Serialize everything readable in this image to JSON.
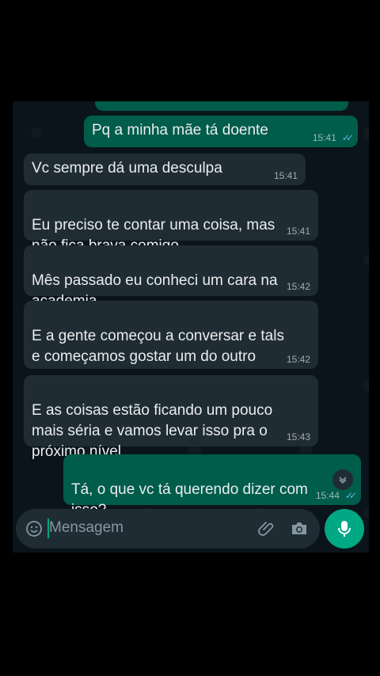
{
  "messages": [
    {
      "text": "Pq a minha mãe tá doente",
      "time": "15:41",
      "dir": "out"
    },
    {
      "text": "Vc sempre dá uma desculpa",
      "time": "15:41",
      "dir": "in"
    },
    {
      "text": "Eu preciso te contar uma coisa, mas\nnão fica brava comigo",
      "time": "15:41",
      "dir": "in"
    },
    {
      "text": "Mês passado eu conheci um cara na\nacademia",
      "time": "15:42",
      "dir": "in"
    },
    {
      "text": "E a gente começou a conversar e tals\ne começamos gostar um do outro",
      "time": "15:42",
      "dir": "in"
    },
    {
      "text": "E as coisas estão ficando um pouco\nmais séria e vamos levar isso pra o\npróximo nível",
      "time": "15:43",
      "dir": "in"
    },
    {
      "text": "Tá, o que vc tá querendo dizer com\nisso?",
      "time": "15:44",
      "dir": "out"
    }
  ],
  "input": {
    "placeholder": "Mensagem"
  },
  "colors": {
    "incoming": "#202c33",
    "outgoing": "#005c4b",
    "accent": "#00a884",
    "read_ticks": "#53bdeb"
  },
  "icons": [
    "emoji-icon",
    "attach-icon",
    "camera-icon",
    "mic-icon",
    "chevron-down-icon",
    "double-check-icon"
  ]
}
